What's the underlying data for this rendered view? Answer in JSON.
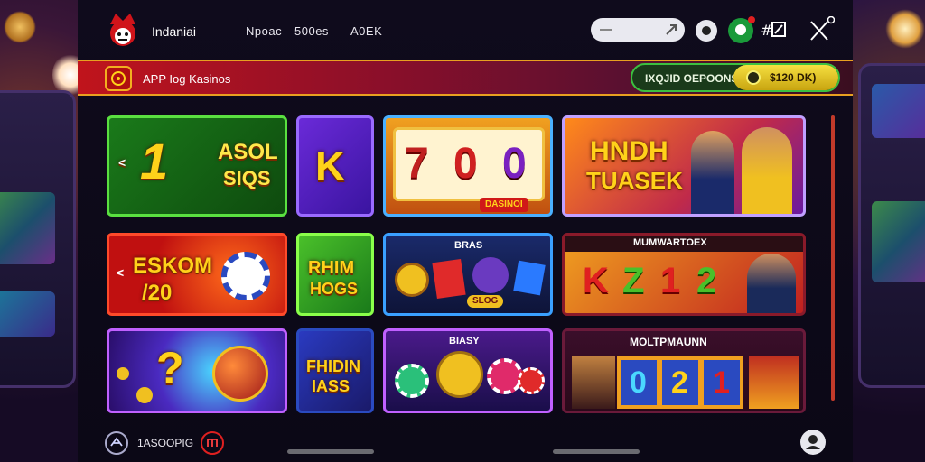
{
  "header": {
    "brand": "Indaniai",
    "nav": [
      "Npoac",
      "500es",
      "A0EK"
    ],
    "search_placeholder": ""
  },
  "promo": {
    "title": "APP Iog Kasinos",
    "coupons_label": "IXQJID OEPOONS",
    "balance": "$120 DK)"
  },
  "tiles": {
    "t1": {
      "big": "1",
      "line1": "ASOL",
      "line2": "SIQS"
    },
    "t2": {
      "big": "K"
    },
    "t3": {
      "reels": [
        "7",
        "0",
        "0"
      ],
      "tag": "DASINOI"
    },
    "t4": {
      "line1": "HNDH",
      "line2": "TUASEK"
    },
    "t5": {
      "line1": "ESKOM",
      "line2": "/20"
    },
    "t6": {
      "line1": "RHIM",
      "line2": "HOGS"
    },
    "t7": {
      "title": "BRAS",
      "tag": "SLOG"
    },
    "t8": {
      "title": "MUMWARTOEX",
      "reels": [
        "K",
        "Z",
        "1",
        "2"
      ]
    },
    "t9": {
      "symbol": "?"
    },
    "t10": {
      "line1": "FHIDIN",
      "line2": "IASS"
    },
    "t11": {
      "title": "BIASY"
    },
    "t12": {
      "title": "MOLTPMAUNN",
      "reels": [
        "0",
        "2",
        "1"
      ]
    }
  },
  "footer": {
    "label": "1ASOOPIG"
  },
  "colors": {
    "accent_red": "#c0141c",
    "accent_gold": "#ffd21a",
    "accent_green": "#3cc040"
  }
}
